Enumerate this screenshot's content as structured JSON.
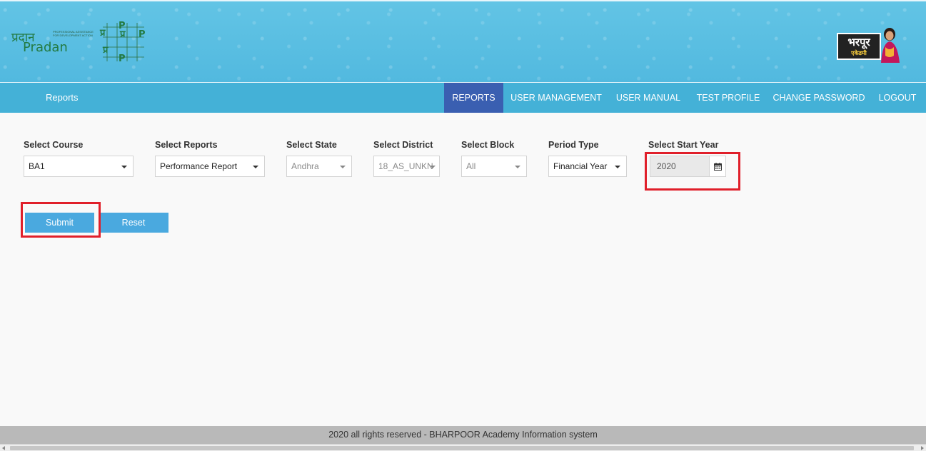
{
  "header": {
    "left_logo": {
      "hindi": "प्रदान",
      "name": "Pradan",
      "tagline": "PROFESSIONAL ASSISTANCE FOR DEVELOPMENT ACTION"
    },
    "center_logo": {
      "letters": [
        "प्र",
        "P",
        "प्र",
        "P",
        "प्र",
        "P"
      ]
    },
    "right_logo": {
      "title": "भरपूर",
      "subtitle": "एकेडमी"
    }
  },
  "navbar": {
    "brand": "Reports",
    "items": [
      {
        "label": "REPORTS",
        "active": true
      },
      {
        "label": "USER MANAGEMENT",
        "active": false
      },
      {
        "label": "USER MANUAL",
        "active": false
      },
      {
        "label": "TEST PROFILE",
        "active": false
      },
      {
        "label": "CHANGE PASSWORD",
        "active": false
      },
      {
        "label": "LOGOUT",
        "active": false
      }
    ]
  },
  "form": {
    "course": {
      "label": "Select Course",
      "value": "BA1"
    },
    "reports": {
      "label": "Select Reports",
      "value": "Performance Report"
    },
    "state": {
      "label": "Select State",
      "value": "Andhra"
    },
    "district": {
      "label": "Select District",
      "value": "18_AS_UNKN"
    },
    "block": {
      "label": "Select Block",
      "value": "All"
    },
    "period": {
      "label": "Period Type",
      "value": "Financial Year"
    },
    "start_year": {
      "label": "Select Start Year",
      "value": "2020"
    },
    "submit_label": "Submit",
    "reset_label": "Reset"
  },
  "footer": {
    "text": "2020 all rights reserved - BHARPOOR Academy Information system"
  },
  "colors": {
    "banner": "#5cc0e2",
    "navbar": "#44b1d7",
    "nav_active": "#3a5fb1",
    "button": "#4aa9df",
    "highlight": "#e01f2a",
    "footer": "#b9b9b9"
  },
  "icons": {
    "calendar": "calendar-icon",
    "dropdown": "caret-down-icon"
  }
}
